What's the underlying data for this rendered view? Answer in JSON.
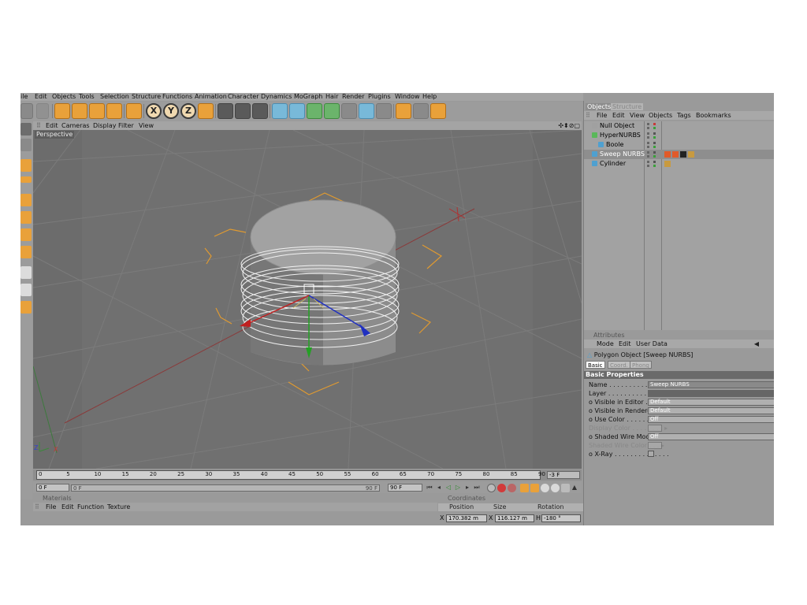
{
  "menubar": [
    "ile",
    "Edit",
    "Objects",
    "Tools",
    "Selection",
    "Structure",
    "Functions",
    "Animation",
    "Character",
    "Dynamics",
    "MoGraph",
    "Hair",
    "Render",
    "Plugins",
    "Window",
    "Help"
  ],
  "viewport": {
    "menu": [
      "Edit",
      "Cameras",
      "Display",
      "Filter",
      "View"
    ],
    "label": "Perspective",
    "nav_icons": "✣⬍⊘▢",
    "axis_z": "Z",
    "axis_x": "X"
  },
  "toolbar": {
    "axis_x": "X",
    "axis_y": "Y",
    "axis_z": "Z"
  },
  "timeline": {
    "ticks": [
      "0",
      "5",
      "10",
      "15",
      "20",
      "25",
      "30",
      "35",
      "40",
      "45",
      "50",
      "55",
      "60",
      "65",
      "70",
      "75",
      "80",
      "85",
      "90"
    ],
    "end_field": "-3 F",
    "current_frame": "0 F",
    "slider_start": "0 F",
    "slider_end": "90 F",
    "max_frame": "90 F"
  },
  "materials": {
    "title": "Materials",
    "menu": [
      "File",
      "Edit",
      "Function",
      "Texture"
    ]
  },
  "coordinates": {
    "title": "Coordinates",
    "headers": [
      "Position",
      "Size",
      "Rotation"
    ],
    "row_x": {
      "label": "X",
      "position": "170.382 m",
      "size_label": "X",
      "size": "116.127 m",
      "rot_label": "H",
      "rotation": "-180 °"
    }
  },
  "objects_manager": {
    "tabs": [
      "Objects",
      "Structure"
    ],
    "menu": [
      "File",
      "Edit",
      "View",
      "Objects",
      "Tags",
      "Bookmarks"
    ],
    "items": [
      {
        "name": "Null Object",
        "level": 0,
        "icon_color": "#a0a0a0",
        "selected": false
      },
      {
        "name": "HyperNURBS",
        "level": 0,
        "icon_color": "#5ab85a",
        "selected": false
      },
      {
        "name": "Boole",
        "level": 1,
        "icon_color": "#4fa0d0",
        "selected": false
      },
      {
        "name": "Sweep NURBS",
        "level": 0,
        "icon_color": "#4fa0d0",
        "selected": true
      },
      {
        "name": "Cylinder",
        "level": 0,
        "icon_color": "#4fa0d0",
        "selected": false
      }
    ]
  },
  "attributes": {
    "title": "Attributes",
    "menu": [
      "Mode",
      "Edit",
      "User Data"
    ],
    "object_name": "Polygon Object [Sweep NURBS]",
    "tabs": [
      "Basic",
      "Coord.",
      "Phong"
    ],
    "section": "Basic Properties",
    "properties": [
      {
        "label": "Name . . . . . . . . . . . . . .",
        "value": "Sweep NURBS",
        "dim": false,
        "type": "field"
      },
      {
        "label": "Layer . . . . . . . . . . . . . .",
        "value": "",
        "dim": false,
        "type": "field"
      },
      {
        "label": "o Visible in Editor . . . . . .",
        "value": "Default",
        "dim": false,
        "type": "field"
      },
      {
        "label": "o Visible in Renderer . . .",
        "value": "Default",
        "dim": false,
        "type": "field"
      },
      {
        "label": "o Use Color . . . . . . . . . . .",
        "value": "Off",
        "dim": false,
        "type": "field"
      },
      {
        "label": "Display Color . . . . . . . . ▸",
        "value": "",
        "dim": true,
        "type": "swatch"
      },
      {
        "label": "o Shaded Wire Mode . . .",
        "value": "Off",
        "dim": false,
        "type": "field"
      },
      {
        "label": "Shaded Wire Color . . . ▸",
        "value": "",
        "dim": true,
        "type": "swatch"
      },
      {
        "label": "o X-Ray . . . . . . . . . . . . . .",
        "value": "",
        "dim": false,
        "type": "check"
      }
    ]
  }
}
